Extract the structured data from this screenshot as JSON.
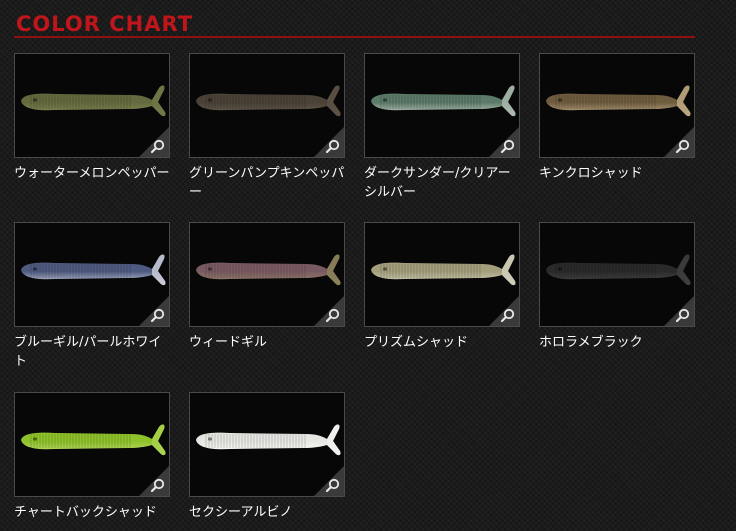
{
  "header": {
    "title": "COLOR CHART"
  },
  "colors": [
    {
      "name": "ウォーターメロンペッパー",
      "body": "#646a3e",
      "belly": "#8d8d5a",
      "tail": "#6f7548"
    },
    {
      "name": "グリーンパンプキンペッパー",
      "body": "#4a4237",
      "belly": "#6b6153",
      "tail": "#5a5044"
    },
    {
      "name": "ダークサンダー/クリアーシルバー",
      "body": "#5b7a68",
      "belly": "#d2d9d3",
      "tail": "#a8b6ab"
    },
    {
      "name": "キンクロシャッド",
      "body": "#6f5b3e",
      "belly": "#c8b691",
      "tail": "#bba77f"
    },
    {
      "name": "ブルーギル/パールホワイト",
      "body": "#4e5a80",
      "belly": "#d6d9e6",
      "tail": "#c9cbd6"
    },
    {
      "name": "ウィードギル",
      "body": "#7a5a62",
      "belly": "#9a8b6a",
      "tail": "#8a8157"
    },
    {
      "name": "プリズムシャッド",
      "body": "#a39f7c",
      "belly": "#d8d6c2",
      "tail": "#d0ceba"
    },
    {
      "name": "ホロラメブラック",
      "body": "#2a2a2a",
      "belly": "#4c4c4c",
      "tail": "#3d3d3d"
    },
    {
      "name": "チャートバックシャッド",
      "body": "#8ec12a",
      "belly": "#c9e37a",
      "tail": "#a8d24a"
    },
    {
      "name": "セクシーアルビノ",
      "body": "#e6e6e2",
      "belly": "#ffffff",
      "tail": "#f0f0ec"
    }
  ]
}
